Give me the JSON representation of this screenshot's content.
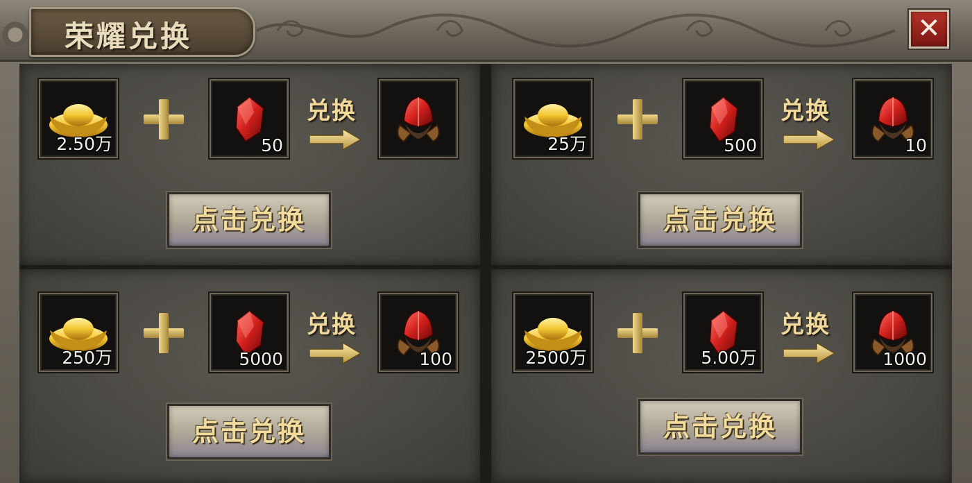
{
  "window": {
    "title": "荣耀兑换",
    "close_label": "✕"
  },
  "exchange_label": "兑换",
  "offers": [
    {
      "gold_amount": "2.50万",
      "gem_amount": "50",
      "reward_amount": "",
      "button_label": "点击兑换"
    },
    {
      "gold_amount": "25万",
      "gem_amount": "500",
      "reward_amount": "10",
      "button_label": "点击兑换"
    },
    {
      "gold_amount": "250万",
      "gem_amount": "5000",
      "reward_amount": "100",
      "button_label": "点击兑换"
    },
    {
      "gold_amount": "2500万",
      "gem_amount": "5.00万",
      "reward_amount": "1000",
      "button_label": "点击兑换"
    }
  ],
  "icons": {
    "currency": "gold-ingot-icon",
    "material": "red-gem-icon",
    "reward": "armored-helmet-icon"
  },
  "colors": {
    "gold_text": "#f0d99a",
    "close_red": "#b6332a",
    "panel": "#4b4943"
  }
}
